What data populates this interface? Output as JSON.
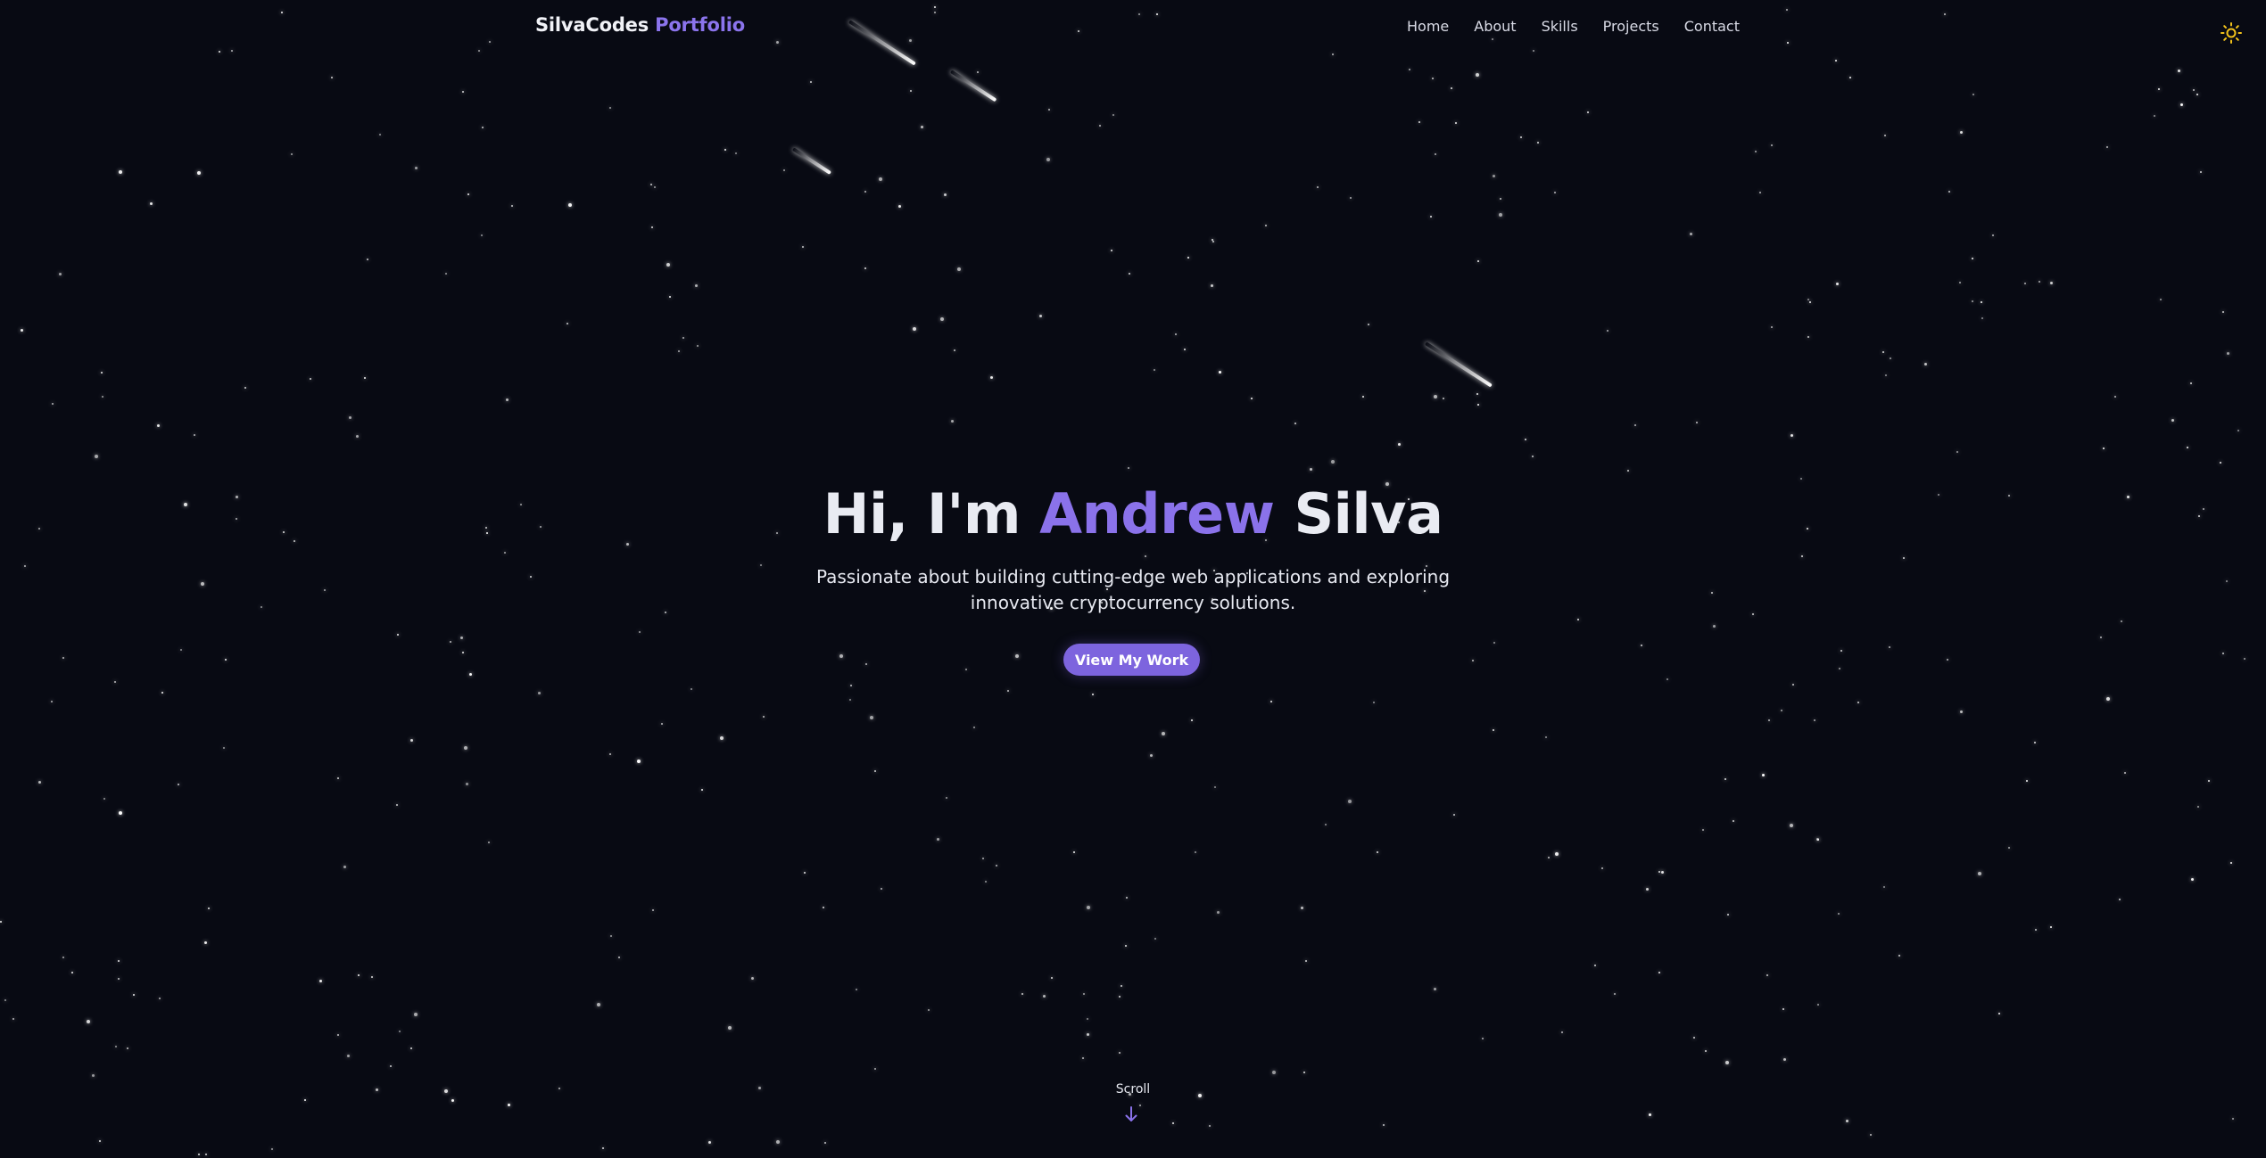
{
  "brand": {
    "name": "SilvaCodes",
    "suffix": "Portfolio"
  },
  "nav": {
    "items": [
      {
        "label": "Home"
      },
      {
        "label": "About"
      },
      {
        "label": "Skills"
      },
      {
        "label": "Projects"
      },
      {
        "label": "Contact"
      }
    ],
    "theme_toggle_icon": "sun-icon"
  },
  "hero": {
    "greeting": "Hi, I'm",
    "first_name": "Andrew",
    "last_name": "Silva",
    "subtitle_line1": "Passionate about building cutting-edge web applications and exploring",
    "subtitle_line2": "innovative cryptocurrency solutions.",
    "cta_label": "View My Work"
  },
  "scroll": {
    "label": "Scroll",
    "icon": "arrow-down-icon"
  },
  "colors": {
    "background": "#080a13",
    "accent": "#8a72ea",
    "button": "#7d64de",
    "text": "#e9ebf2",
    "sun": "#f2c21b"
  }
}
